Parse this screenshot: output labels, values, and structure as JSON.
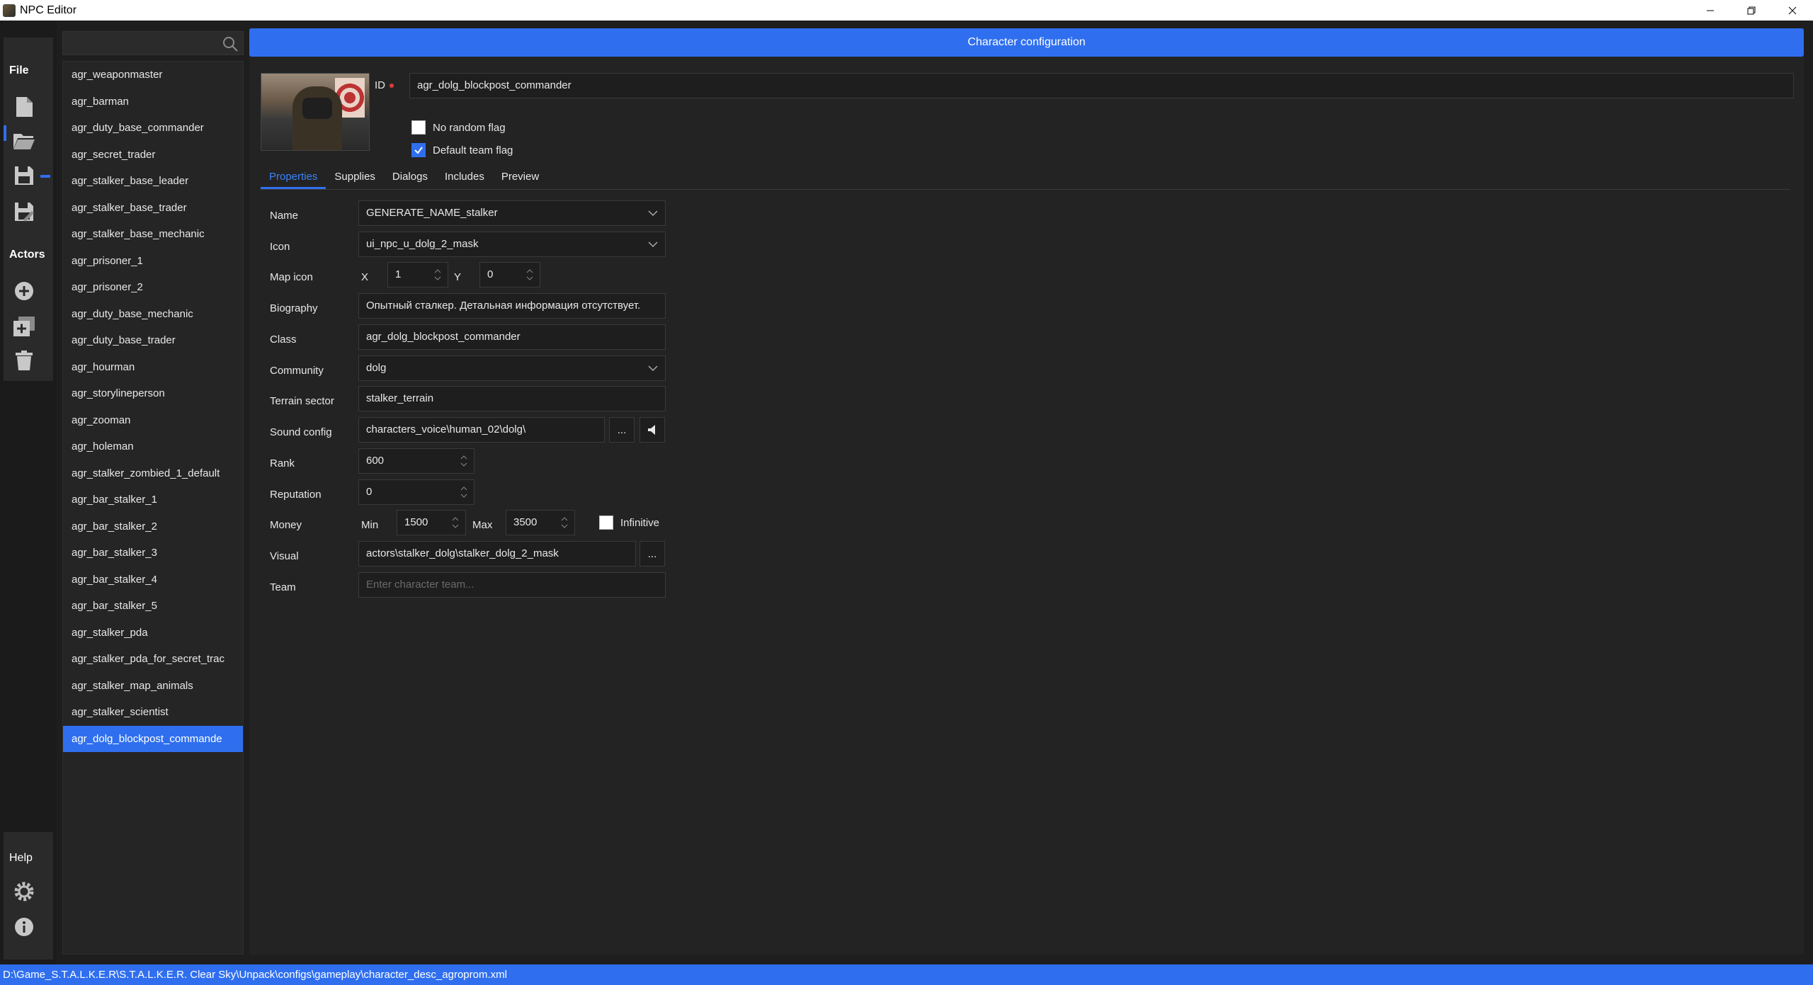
{
  "window": {
    "title": "NPC Editor"
  },
  "rail": {
    "file_label": "File",
    "actors_label": "Actors",
    "help_label": "Help"
  },
  "header": {
    "title": "Character configuration"
  },
  "actors": [
    "agr_weaponmaster",
    "agr_barman",
    "agr_duty_base_commander",
    "agr_secret_trader",
    "agr_stalker_base_leader",
    "agr_stalker_base_trader",
    "agr_stalker_base_mechanic",
    "agr_prisoner_1",
    "agr_prisoner_2",
    "agr_duty_base_mechanic",
    "agr_duty_base_trader",
    "agr_hourman",
    "agr_storylineperson",
    "agr_zooman",
    "agr_holeman",
    "agr_stalker_zombied_1_default",
    "agr_bar_stalker_1",
    "agr_bar_stalker_2",
    "agr_bar_stalker_3",
    "agr_bar_stalker_4",
    "agr_bar_stalker_5",
    "agr_stalker_pda",
    "agr_stalker_pda_for_secret_trac",
    "agr_stalker_map_animals",
    "agr_stalker_scientist",
    "agr_dolg_blockpost_commande"
  ],
  "character": {
    "id_label": "ID",
    "id_value": "agr_dolg_blockpost_commander",
    "no_random_flag": "No random flag",
    "default_team_flag": "Default team flag"
  },
  "tabs": [
    "Properties",
    "Supplies",
    "Dialogs",
    "Includes",
    "Preview"
  ],
  "props": {
    "name_label": "Name",
    "name_value": "GENERATE_NAME_stalker",
    "icon_label": "Icon",
    "icon_value": "ui_npc_u_dolg_2_mask",
    "map_icon_label": "Map icon",
    "x_label": "X",
    "x_value": "1",
    "y_label": "Y",
    "y_value": "0",
    "biography_label": "Biography",
    "biography_value": "Опытный сталкер. Детальная информация отсутствует.",
    "class_label": "Class",
    "class_value": "agr_dolg_blockpost_commander",
    "community_label": "Community",
    "community_value": "dolg",
    "terrain_label": "Terrain sector",
    "terrain_value": "stalker_terrain",
    "sound_label": "Sound config",
    "sound_value": "characters_voice\\human_02\\dolg\\",
    "browse_label": "...",
    "rank_label": "Rank",
    "rank_value": "600",
    "reputation_label": "Reputation",
    "reputation_value": "0",
    "money_label": "Money",
    "min_label": "Min",
    "min_value": "1500",
    "max_label": "Max",
    "max_value": "3500",
    "infinitive_label": "Infinitive",
    "visual_label": "Visual",
    "visual_value": "actors\\stalker_dolg\\stalker_dolg_2_mask",
    "team_label": "Team",
    "team_placeholder": "Enter character team..."
  },
  "status": {
    "path": "D:\\Game_S.T.A.L.K.E.R\\S.T.A.L.K.E.R. Clear Sky\\Unpack\\configs\\gameplay\\character_desc_agroprom.xml"
  }
}
